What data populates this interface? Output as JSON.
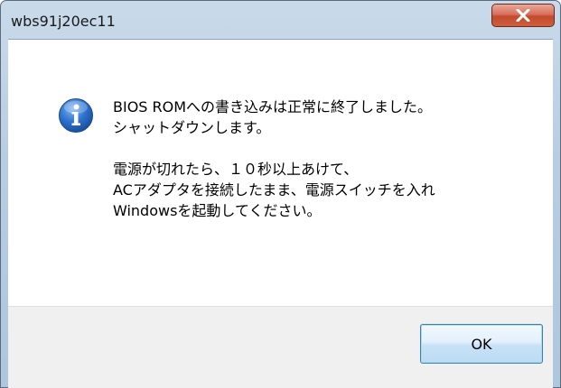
{
  "window": {
    "title": "wbs91j20ec11"
  },
  "dialog": {
    "icon": "info-icon",
    "lines": [
      "BIOS ROMへの書き込みは正常に終了しました。",
      "シャットダウンします。",
      "",
      "電源が切れたら、１０秒以上あけて、",
      "ACアダプタを接続したまま、電源スイッチを入れ",
      "Windowsを起動してください。"
    ],
    "ok_label": "OK"
  },
  "colors": {
    "accent": "#3c7fb1",
    "close_button": "#c24a2e"
  }
}
